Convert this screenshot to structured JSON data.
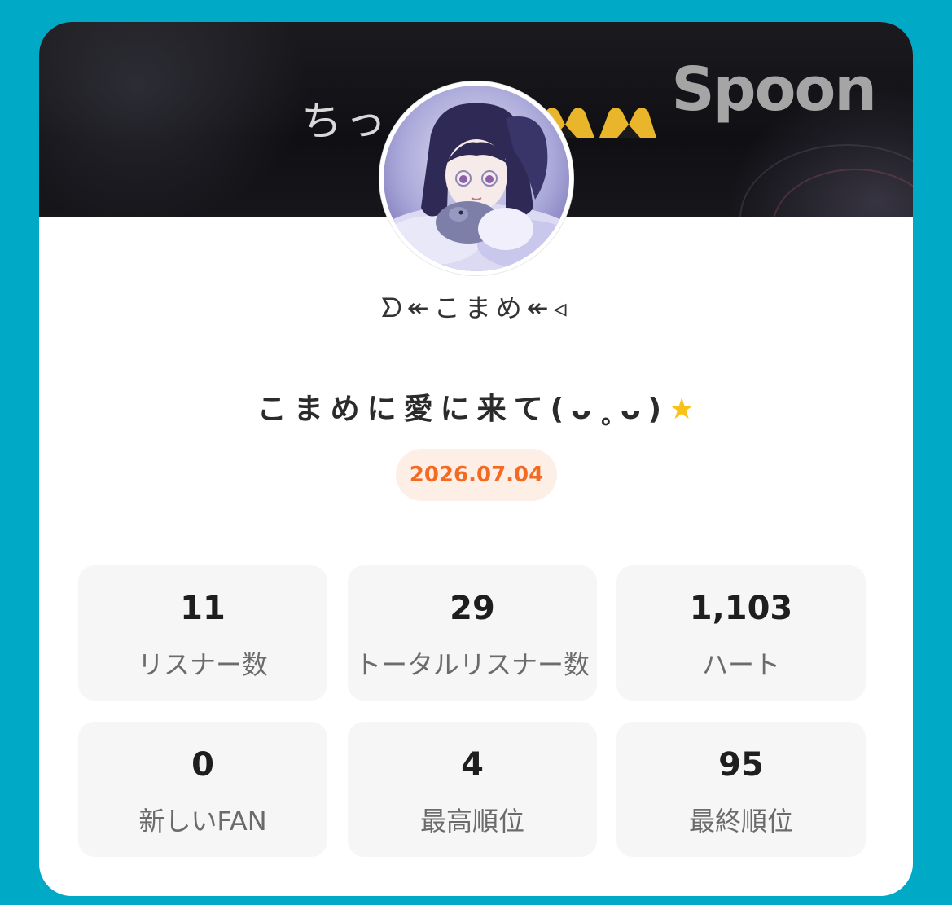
{
  "banner": {
    "text": "ちっ",
    "brand": "Spoon"
  },
  "profile": {
    "username": "ᗤ↞こまめ↞◃",
    "avatar_icon": "avatar-anime-girl"
  },
  "room": {
    "title": "こまめに愛に来て(ᴗ˳ᴗ)",
    "title_icon": "star-icon",
    "date": "2026.07.04"
  },
  "colors": {
    "background": "#00a9c6",
    "date_accent": "#f46a23",
    "date_badge_bg": "#fdeee6",
    "stat_card_bg": "#f6f6f6"
  },
  "stats": [
    {
      "value": "11",
      "label": "リスナー数"
    },
    {
      "value": "29",
      "label": "トータルリスナー数"
    },
    {
      "value": "1,103",
      "label": "ハート"
    },
    {
      "value": "0",
      "label": "新しいFAN"
    },
    {
      "value": "4",
      "label": "最高順位"
    },
    {
      "value": "95",
      "label": "最終順位"
    }
  ]
}
